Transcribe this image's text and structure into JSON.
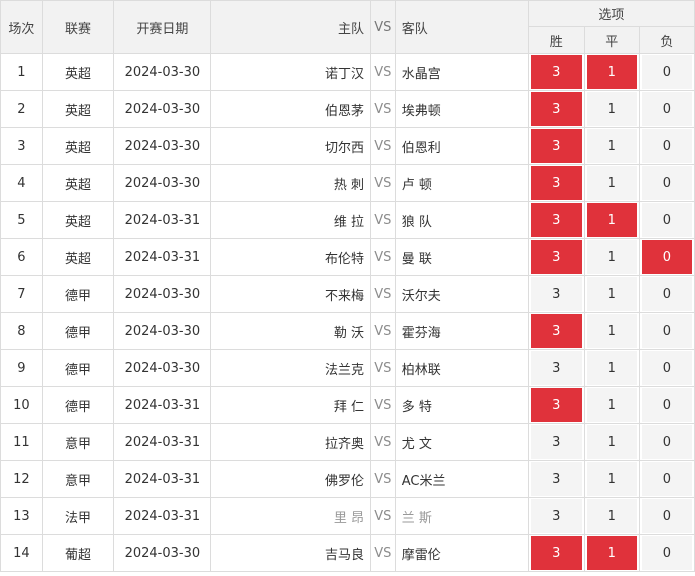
{
  "header": {
    "col_index": "场次",
    "col_league": "联赛",
    "col_date": "开赛日期",
    "col_home": "主队",
    "col_vs": "VS",
    "col_away": "客队",
    "options_title": "选项",
    "opt_win": "胜",
    "opt_draw": "平",
    "opt_lose": "负"
  },
  "rows": [
    {
      "no": "1",
      "league": "英超",
      "date": "2024-03-30",
      "home": "诺丁汉",
      "vs": "VS",
      "away": "水晶宫",
      "win": "3",
      "draw": "1",
      "lose": "0"
    },
    {
      "no": "2",
      "league": "英超",
      "date": "2024-03-30",
      "home": "伯恩茅",
      "vs": "VS",
      "away": "埃弗顿",
      "win": "3",
      "draw": "1",
      "lose": "0"
    },
    {
      "no": "3",
      "league": "英超",
      "date": "2024-03-30",
      "home": "切尔西",
      "vs": "VS",
      "away": "伯恩利",
      "win": "3",
      "draw": "1",
      "lose": "0"
    },
    {
      "no": "4",
      "league": "英超",
      "date": "2024-03-30",
      "home": "热 刺",
      "vs": "VS",
      "away": "卢 顿",
      "win": "3",
      "draw": "1",
      "lose": "0"
    },
    {
      "no": "5",
      "league": "英超",
      "date": "2024-03-31",
      "home": "维 拉",
      "vs": "VS",
      "away": "狼 队",
      "win": "3",
      "draw": "1",
      "lose": "0"
    },
    {
      "no": "6",
      "league": "英超",
      "date": "2024-03-31",
      "home": "布伦特",
      "vs": "VS",
      "away": "曼 联",
      "win": "3",
      "draw": "1",
      "lose": "0"
    },
    {
      "no": "7",
      "league": "德甲",
      "date": "2024-03-30",
      "home": "不来梅",
      "vs": "VS",
      "away": "沃尔夫",
      "win": "3",
      "draw": "1",
      "lose": "0"
    },
    {
      "no": "8",
      "league": "德甲",
      "date": "2024-03-30",
      "home": "勒 沃",
      "vs": "VS",
      "away": "霍芬海",
      "win": "3",
      "draw": "1",
      "lose": "0"
    },
    {
      "no": "9",
      "league": "德甲",
      "date": "2024-03-30",
      "home": "法兰克",
      "vs": "VS",
      "away": "柏林联",
      "win": "3",
      "draw": "1",
      "lose": "0"
    },
    {
      "no": "10",
      "league": "德甲",
      "date": "2024-03-31",
      "home": "拜 仁",
      "vs": "VS",
      "away": "多 特",
      "win": "3",
      "draw": "1",
      "lose": "0"
    },
    {
      "no": "11",
      "league": "意甲",
      "date": "2024-03-31",
      "home": "拉齐奥",
      "vs": "VS",
      "away": "尤 文",
      "win": "3",
      "draw": "1",
      "lose": "0"
    },
    {
      "no": "12",
      "league": "意甲",
      "date": "2024-03-31",
      "home": "佛罗伦",
      "vs": "VS",
      "away": "AC米兰",
      "win": "3",
      "draw": "1",
      "lose": "0"
    },
    {
      "no": "13",
      "league": "法甲",
      "date": "2024-03-31",
      "home": "里 昂",
      "vs": "VS",
      "away": "兰 斯",
      "win": "3",
      "draw": "1",
      "lose": "0"
    },
    {
      "no": "14",
      "league": "葡超",
      "date": "2024-03-30",
      "home": "吉马良",
      "vs": "VS",
      "away": "摩雷伦",
      "win": "3",
      "draw": "1",
      "lose": "0"
    }
  ],
  "selections": [
    {
      "win": true,
      "draw": true,
      "lose": false
    },
    {
      "win": true,
      "draw": false,
      "lose": false
    },
    {
      "win": true,
      "draw": false,
      "lose": false
    },
    {
      "win": true,
      "draw": false,
      "lose": false
    },
    {
      "win": true,
      "draw": true,
      "lose": false
    },
    {
      "win": true,
      "draw": false,
      "lose": true
    },
    {
      "win": false,
      "draw": false,
      "lose": false
    },
    {
      "win": true,
      "draw": false,
      "lose": false
    },
    {
      "win": false,
      "draw": false,
      "lose": false
    },
    {
      "win": true,
      "draw": false,
      "lose": false
    },
    {
      "win": false,
      "draw": false,
      "lose": false
    },
    {
      "win": false,
      "draw": false,
      "lose": false
    },
    {
      "win": false,
      "draw": false,
      "lose": false
    },
    {
      "win": true,
      "draw": true,
      "lose": false
    }
  ],
  "muted_rows": [
    false,
    false,
    false,
    false,
    false,
    false,
    false,
    false,
    false,
    false,
    false,
    false,
    true,
    false
  ],
  "colors": {
    "selected": "#e0323b",
    "unselected": "#f4f4f4",
    "header_bg": "#f2f2f2",
    "border": "#dcdcdc"
  }
}
